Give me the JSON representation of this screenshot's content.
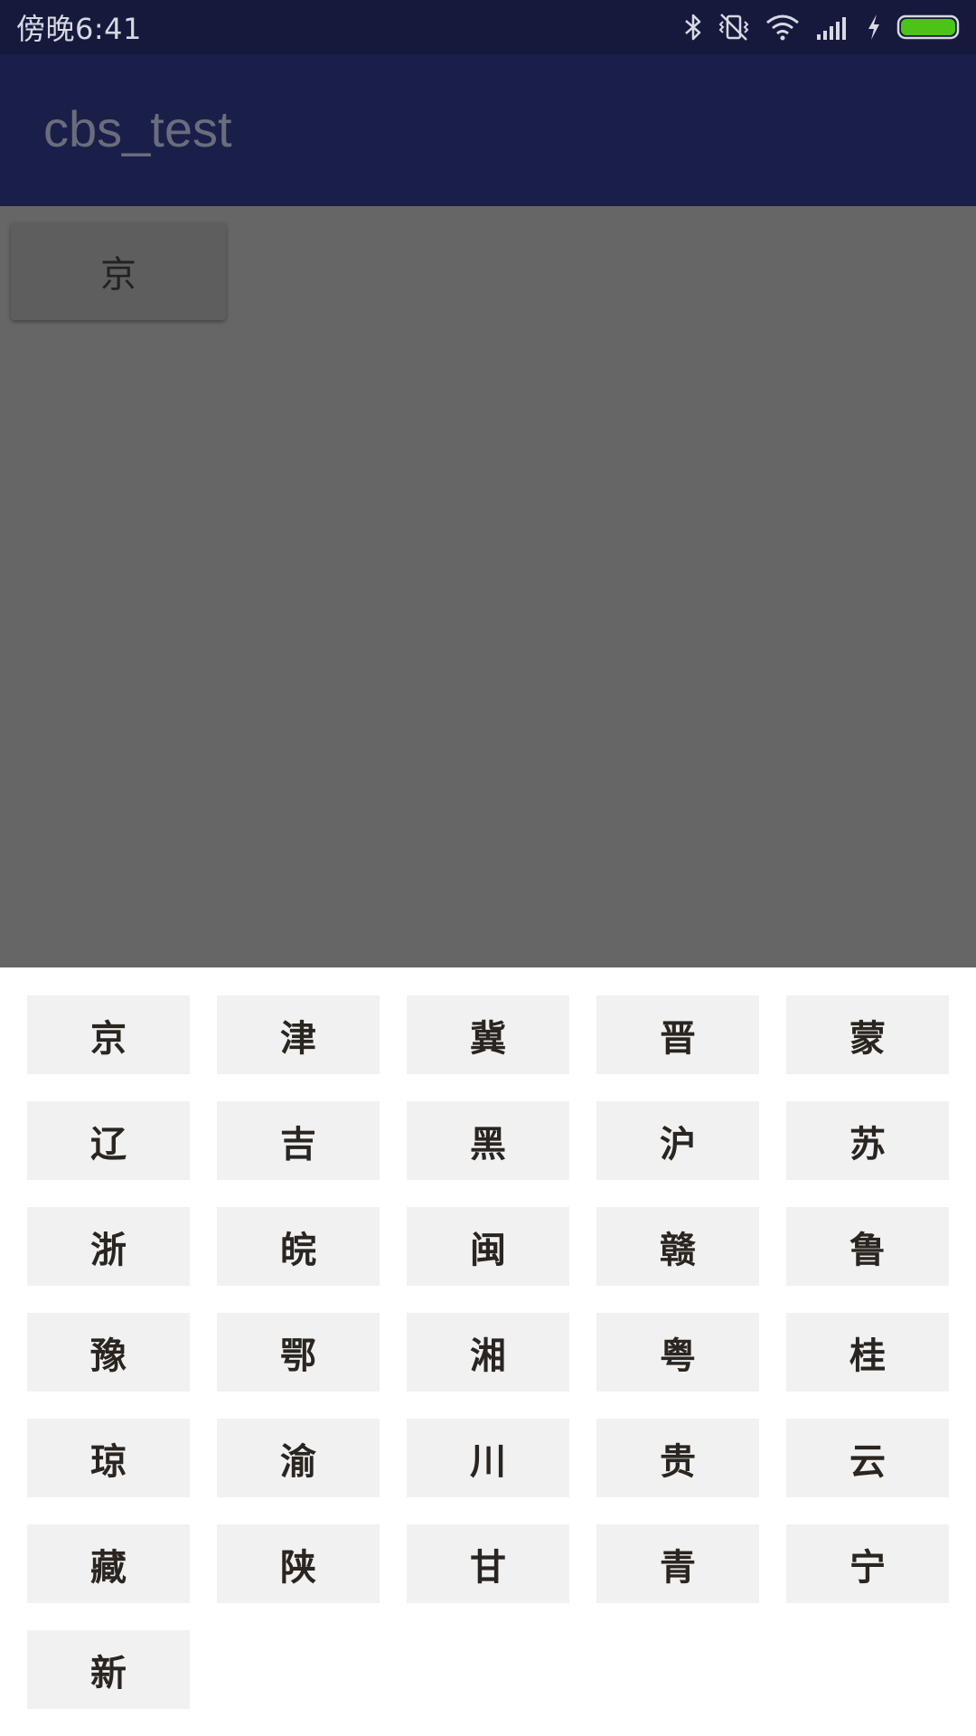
{
  "status_bar": {
    "time": "傍晚6:41",
    "icons": [
      "bluetooth-icon",
      "vibrate-icon",
      "wifi-icon",
      "signal-icon",
      "charging-icon",
      "battery-icon"
    ],
    "battery_color": "#4cc417"
  },
  "app_bar": {
    "title": "cbs_test",
    "color": "#1a1f4a"
  },
  "content": {
    "selected_province": "京"
  },
  "keyboard": {
    "keys": [
      "京",
      "津",
      "冀",
      "晋",
      "蒙",
      "辽",
      "吉",
      "黑",
      "沪",
      "苏",
      "浙",
      "皖",
      "闽",
      "赣",
      "鲁",
      "豫",
      "鄂",
      "湘",
      "粤",
      "桂",
      "琼",
      "渝",
      "川",
      "贵",
      "云",
      "藏",
      "陕",
      "甘",
      "青",
      "宁",
      "新"
    ]
  }
}
